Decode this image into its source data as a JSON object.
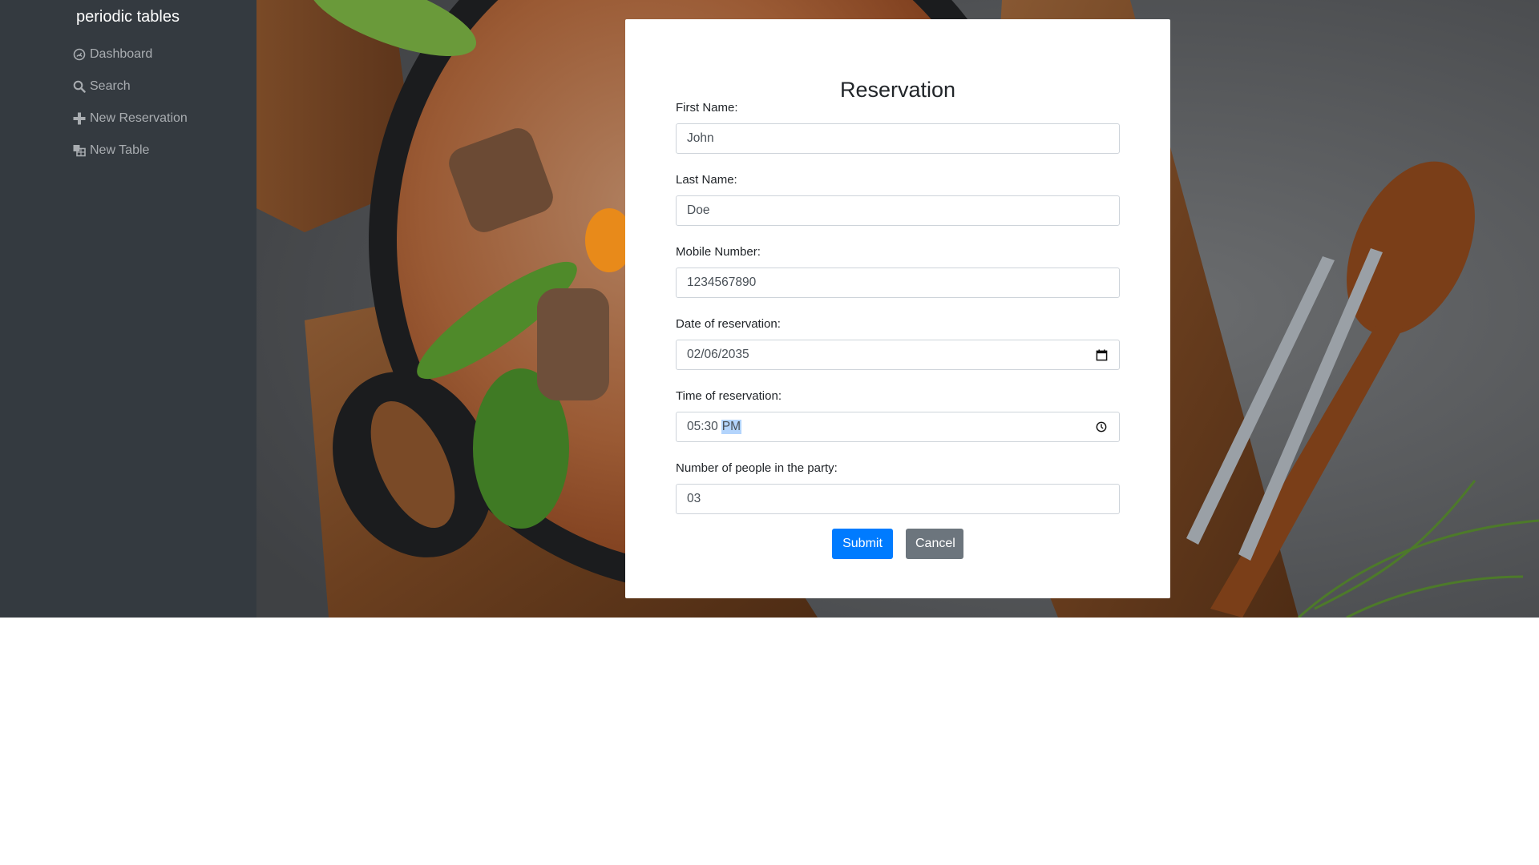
{
  "brand": "periodic tables",
  "nav": [
    {
      "label": "Dashboard",
      "icon": "dashboard-icon"
    },
    {
      "label": "Search",
      "icon": "search-icon"
    },
    {
      "label": "New Reservation",
      "icon": "plus-icon"
    },
    {
      "label": "New Table",
      "icon": "table-icon"
    }
  ],
  "form": {
    "title": "Reservation",
    "first_name": {
      "label": "First Name:",
      "value": "John"
    },
    "last_name": {
      "label": "Last Name:",
      "value": "Doe"
    },
    "mobile": {
      "label": "Mobile Number:",
      "value": "1234567890"
    },
    "date": {
      "label": "Date of reservation:",
      "value": "02/06/2035"
    },
    "time": {
      "label": "Time of reservation:",
      "value_time": "05:30",
      "value_ampm": "PM"
    },
    "people": {
      "label": "Number of people in the party:",
      "value": "03"
    },
    "submit_label": "Submit",
    "cancel_label": "Cancel"
  },
  "colors": {
    "sidebar_bg": "#343a40",
    "primary": "#007bff",
    "secondary": "#6c757d"
  }
}
